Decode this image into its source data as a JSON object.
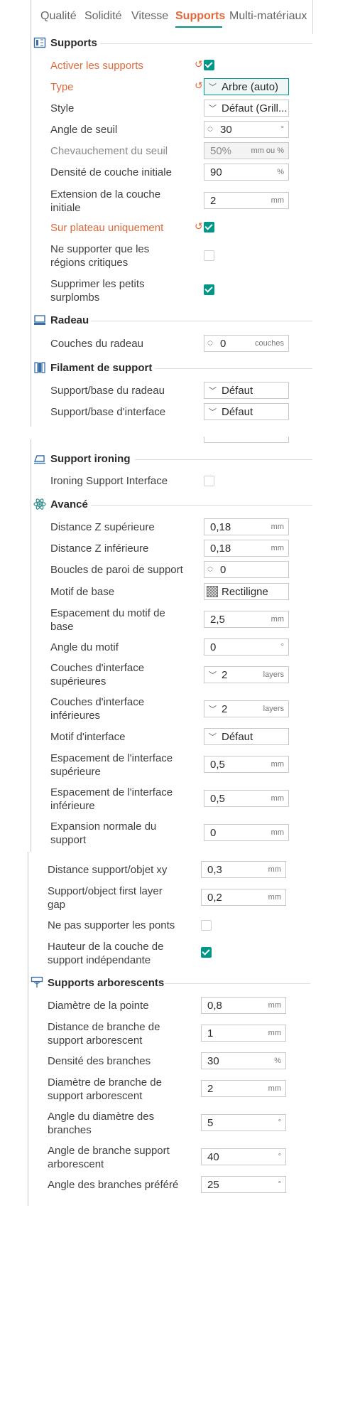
{
  "tabs": [
    {
      "label": "Qualité"
    },
    {
      "label": "Solidité"
    },
    {
      "label": "Vitesse"
    },
    {
      "label": "Supports"
    },
    {
      "label": "Multi-matériaux"
    }
  ],
  "sections": {
    "supports": "Supports",
    "raft": "Radeau",
    "filament": "Filament de support",
    "ironing": "Support ironing",
    "advanced": "Avancé",
    "tree": "Supports arborescents"
  },
  "supports": {
    "enable": {
      "label": "Activer les supports",
      "checked": true
    },
    "type": {
      "label": "Type",
      "value": "Arbre (auto)"
    },
    "style": {
      "label": "Style",
      "value": "Défaut (Grill..."
    },
    "threshold_angle": {
      "label": "Angle de seuil",
      "value": "30",
      "unit": "°"
    },
    "threshold_overlap": {
      "label": "Chevauchement du seuil",
      "value": "50%",
      "unit": "mm ou %"
    },
    "initial_density": {
      "label": "Densité de couche initiale",
      "value": "90",
      "unit": "%"
    },
    "initial_extension": {
      "label1": "Extension de la couche",
      "label2": "initiale",
      "value": "2",
      "unit": "mm"
    },
    "on_build_plate": {
      "label": "Sur plateau uniquement",
      "checked": true
    },
    "critical_only": {
      "label1": "Ne supporter que les",
      "label2": "régions critiques",
      "checked": false
    },
    "remove_small": {
      "label1": "Supprimer les petits",
      "label2": "surplombs",
      "checked": true
    }
  },
  "raft": {
    "layers": {
      "label": "Couches du radeau",
      "value": "0",
      "unit": "couches"
    }
  },
  "filament": {
    "raft_base": {
      "label": "Support/base du radeau",
      "value": "Défaut"
    },
    "interface": {
      "label": "Support/base d'interface",
      "value": "Défaut"
    }
  },
  "ironing": {
    "interface": {
      "label": "Ironing Support Interface",
      "checked": false
    }
  },
  "advanced": {
    "top_z": {
      "label": "Distance Z supérieure",
      "value": "0,18",
      "unit": "mm"
    },
    "bottom_z": {
      "label": "Distance Z inférieure",
      "value": "0,18",
      "unit": "mm"
    },
    "wall_loops": {
      "label": "Boucles de paroi de support",
      "value": "0"
    },
    "base_pattern": {
      "label": "Motif de base",
      "value": "Rectiligne"
    },
    "base_spacing": {
      "label1": "Espacement du motif de",
      "label2": "base",
      "value": "2,5",
      "unit": "mm"
    },
    "pattern_angle": {
      "label": "Angle du motif",
      "value": "0",
      "unit": "°"
    },
    "top_interface_layers": {
      "label1": "Couches d'interface",
      "label2": "supérieures",
      "value": "2",
      "unit": "layers"
    },
    "bottom_interface_layers": {
      "label1": "Couches d'interface",
      "label2": "inférieures",
      "value": "2",
      "unit": "layers"
    },
    "interface_pattern": {
      "label": "Motif d'interface",
      "value": "Défaut"
    },
    "top_interface_spacing": {
      "label1": "Espacement de l'interface",
      "label2": "supérieure",
      "value": "0,5",
      "unit": "mm"
    },
    "bottom_interface_spacing": {
      "label1": "Espacement de l'interface",
      "label2": "inférieure",
      "value": "0,5",
      "unit": "mm"
    },
    "normal_expansion": {
      "label1": "Expansion normale du",
      "label2": "support",
      "value": "0",
      "unit": "mm"
    },
    "xy_distance": {
      "label": "Distance support/objet xy",
      "value": "0,3",
      "unit": "mm"
    },
    "first_layer_gap": {
      "label1": "Support/object first layer",
      "label2": "gap",
      "value": "0,2",
      "unit": "mm"
    },
    "no_bridges": {
      "label": "Ne pas supporter les ponts",
      "checked": false
    },
    "independent_height": {
      "label1": "Hauteur de la couche de",
      "label2": "support indépendante",
      "checked": true
    }
  },
  "tree": {
    "tip_diameter": {
      "label": "Diamètre de la pointe",
      "value": "0,8",
      "unit": "mm"
    },
    "branch_distance": {
      "label1": "Distance de branche de",
      "label2": "support arborescent",
      "value": "1",
      "unit": "mm"
    },
    "branch_density": {
      "label": "Densité des branches",
      "value": "30",
      "unit": "%"
    },
    "branch_diameter": {
      "label1": "Diamètre de branche de",
      "label2": "support arborescent",
      "value": "2",
      "unit": "mm"
    },
    "diameter_angle": {
      "label1": "Angle du diamètre des",
      "label2": "branches",
      "value": "5",
      "unit": "°"
    },
    "branch_angle": {
      "label1": "Angle de branche support",
      "label2": "arborescent",
      "value": "40",
      "unit": "°"
    },
    "preferred_angle": {
      "label": "Angle des branches préféré",
      "value": "25",
      "unit": "°"
    }
  },
  "colors": {
    "accent": "#009688",
    "modified": "#e0683b"
  }
}
